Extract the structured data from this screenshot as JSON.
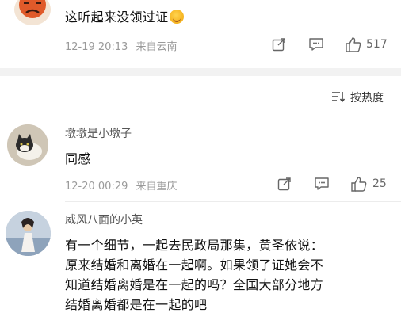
{
  "comments": [
    {
      "text": "这听起来没领过证",
      "emoji": "face-savoring-food",
      "timestamp": "12-19 20:13",
      "location": "来自云南",
      "likes": "517"
    },
    {
      "username": "墩墩是小墩子",
      "text": "同感",
      "timestamp": "12-20 00:29",
      "location": "来自重庆",
      "likes": "25"
    },
    {
      "username": "威风八面的小英",
      "lines": [
        "有一个细节，一起去民政局那集，黄圣依说：",
        "原来结婚和离婚在一起啊。如果领了证她会不",
        "知道结婚离婚是在一起的吗？全国大部分地方",
        "结婚离婚都是在一起的吧"
      ]
    }
  ],
  "sort": {
    "label": "按热度"
  }
}
